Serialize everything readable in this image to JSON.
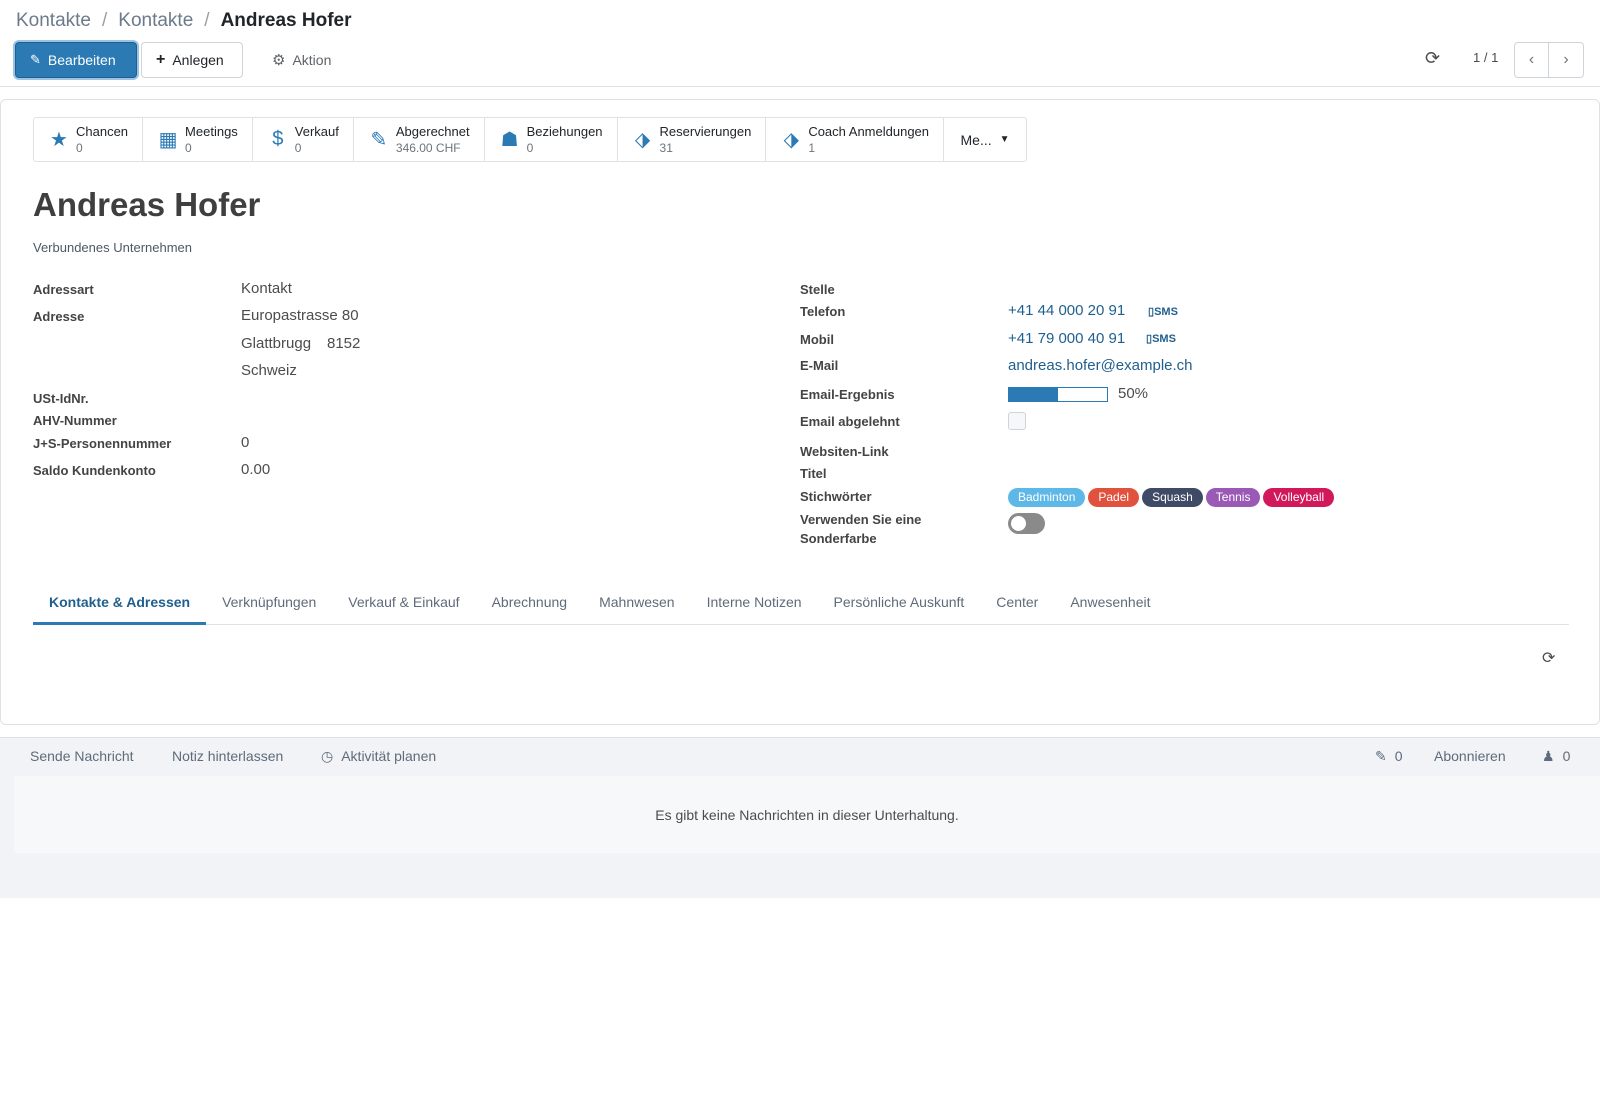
{
  "breadcrumb": [
    "Kontakte",
    "Kontakte",
    "Andreas Hofer"
  ],
  "toolbar": {
    "edit_label": "Bearbeiten",
    "create_label": "Anlegen",
    "action_label": "Aktion"
  },
  "pager": {
    "value": "1 / 1"
  },
  "smart_buttons": [
    {
      "icon": "star-icon",
      "glyph": "★",
      "label": "Chancen",
      "value": "0"
    },
    {
      "icon": "calendar-icon",
      "glyph": "▦",
      "label": "Meetings",
      "value": "0"
    },
    {
      "icon": "dollar-icon",
      "glyph": "$",
      "label": "Verkauf",
      "value": "0"
    },
    {
      "icon": "edit-icon",
      "glyph": "✎",
      "label": "Abgerechnet",
      "value": "346.00 CHF"
    },
    {
      "icon": "users-icon",
      "glyph": "☗",
      "label": "Beziehungen",
      "value": "0"
    },
    {
      "icon": "ticket-icon",
      "glyph": "⬗",
      "label": "Reservierungen",
      "value": "31"
    },
    {
      "icon": "ticket-icon",
      "glyph": "⬗",
      "label": "Coach Anmeldungen",
      "value": "1"
    }
  ],
  "more_label": "Me...",
  "record": {
    "name": "Andreas Hofer",
    "company_placeholder": "Verbundenes Unternehmen"
  },
  "left_fields": {
    "adressart_label": "Adressart",
    "adressart_value": "Kontakt",
    "adresse_label": "Adresse",
    "street": "Europastrasse 80",
    "city": "Glattbrugg",
    "zip": "8152",
    "country": "Schweiz",
    "vat_label": "USt-IdNr.",
    "ahv_label": "AHV-Nummer",
    "js_label": "J+S-Personennummer",
    "js_value": "0",
    "saldo_label": "Saldo Kundenkonto",
    "saldo_value": "0.00"
  },
  "right_fields": {
    "stelle_label": "Stelle",
    "telefon_label": "Telefon",
    "telefon_value": "+41 44 000 20 91",
    "mobil_label": "Mobil",
    "mobil_value": "+41 79 000 40 91",
    "sms_label": "SMS",
    "email_label": "E-Mail",
    "email_value": "andreas.hofer@example.ch",
    "email_result_label": "Email-Ergebnis",
    "email_result_value": "50%",
    "email_result_fraction": 0.5,
    "email_declined_label": "Email abgelehnt",
    "website_label": "Websiten-Link",
    "titel_label": "Titel",
    "tags_label": "Stichwörter",
    "color_label_1": "Verwenden Sie eine",
    "color_label_2": "Sonderfarbe"
  },
  "tags": [
    {
      "label": "Badminton",
      "color": "#5db8e8"
    },
    {
      "label": "Padel",
      "color": "#e0523e"
    },
    {
      "label": "Squash",
      "color": "#3f4a66"
    },
    {
      "label": "Tennis",
      "color": "#9b59b6"
    },
    {
      "label": "Volleyball",
      "color": "#d1185a"
    }
  ],
  "tabs": [
    "Kontakte & Adressen",
    "Verknüpfungen",
    "Verkauf & Einkauf",
    "Abrechnung",
    "Mahnwesen",
    "Interne Notizen",
    "Persönliche Auskunft",
    "Center",
    "Anwesenheit"
  ],
  "chatter": {
    "send_message": "Sende Nachricht",
    "log_note": "Notiz hinterlassen",
    "schedule_activity": "Aktivität planen",
    "attachments_count": "0",
    "follow_label": "Abonnieren",
    "followers_count": "0",
    "empty_message": "Es gibt keine Nachrichten in dieser Unterhaltung."
  }
}
